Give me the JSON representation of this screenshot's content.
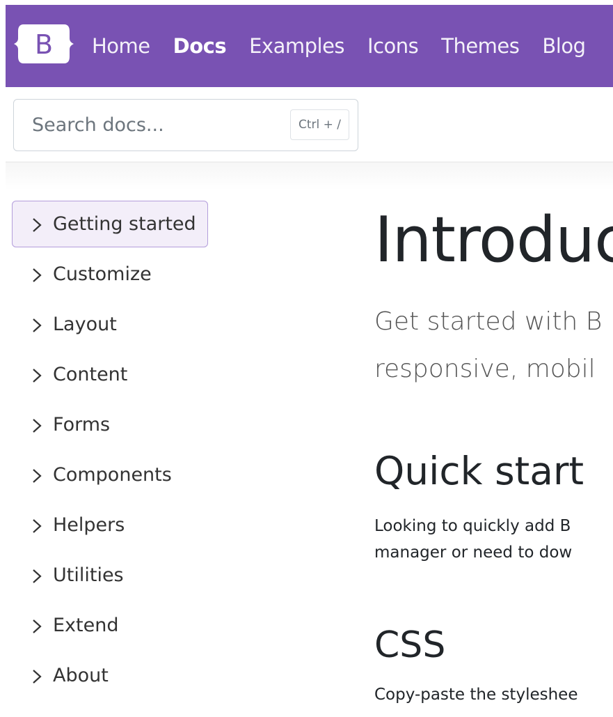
{
  "navbar": {
    "brand_letter": "B",
    "links": [
      {
        "label": "Home",
        "active": false
      },
      {
        "label": "Docs",
        "active": true
      },
      {
        "label": "Examples",
        "active": false
      },
      {
        "label": "Icons",
        "active": false
      },
      {
        "label": "Themes",
        "active": false
      },
      {
        "label": "Blog",
        "active": false
      }
    ],
    "color": "#7952b3"
  },
  "search": {
    "placeholder": "Search docs...",
    "shortcut": "Ctrl + /"
  },
  "sidebar": {
    "items": [
      {
        "label": "Getting started",
        "active": true
      },
      {
        "label": "Customize",
        "active": false
      },
      {
        "label": "Layout",
        "active": false
      },
      {
        "label": "Content",
        "active": false
      },
      {
        "label": "Forms",
        "active": false
      },
      {
        "label": "Components",
        "active": false
      },
      {
        "label": "Helpers",
        "active": false
      },
      {
        "label": "Utilities",
        "active": false
      },
      {
        "label": "Extend",
        "active": false
      },
      {
        "label": "About",
        "active": false
      }
    ]
  },
  "main": {
    "title": "Introduc",
    "lead_line1": "Get started with B",
    "lead_line2": "responsive, mobil",
    "quick_start_heading": "Quick start",
    "quick_start_line1": "Looking to quickly add B",
    "quick_start_line2": "manager or need to dow",
    "css_heading": "CSS",
    "css_line1": "Copy-paste the styleshee"
  }
}
